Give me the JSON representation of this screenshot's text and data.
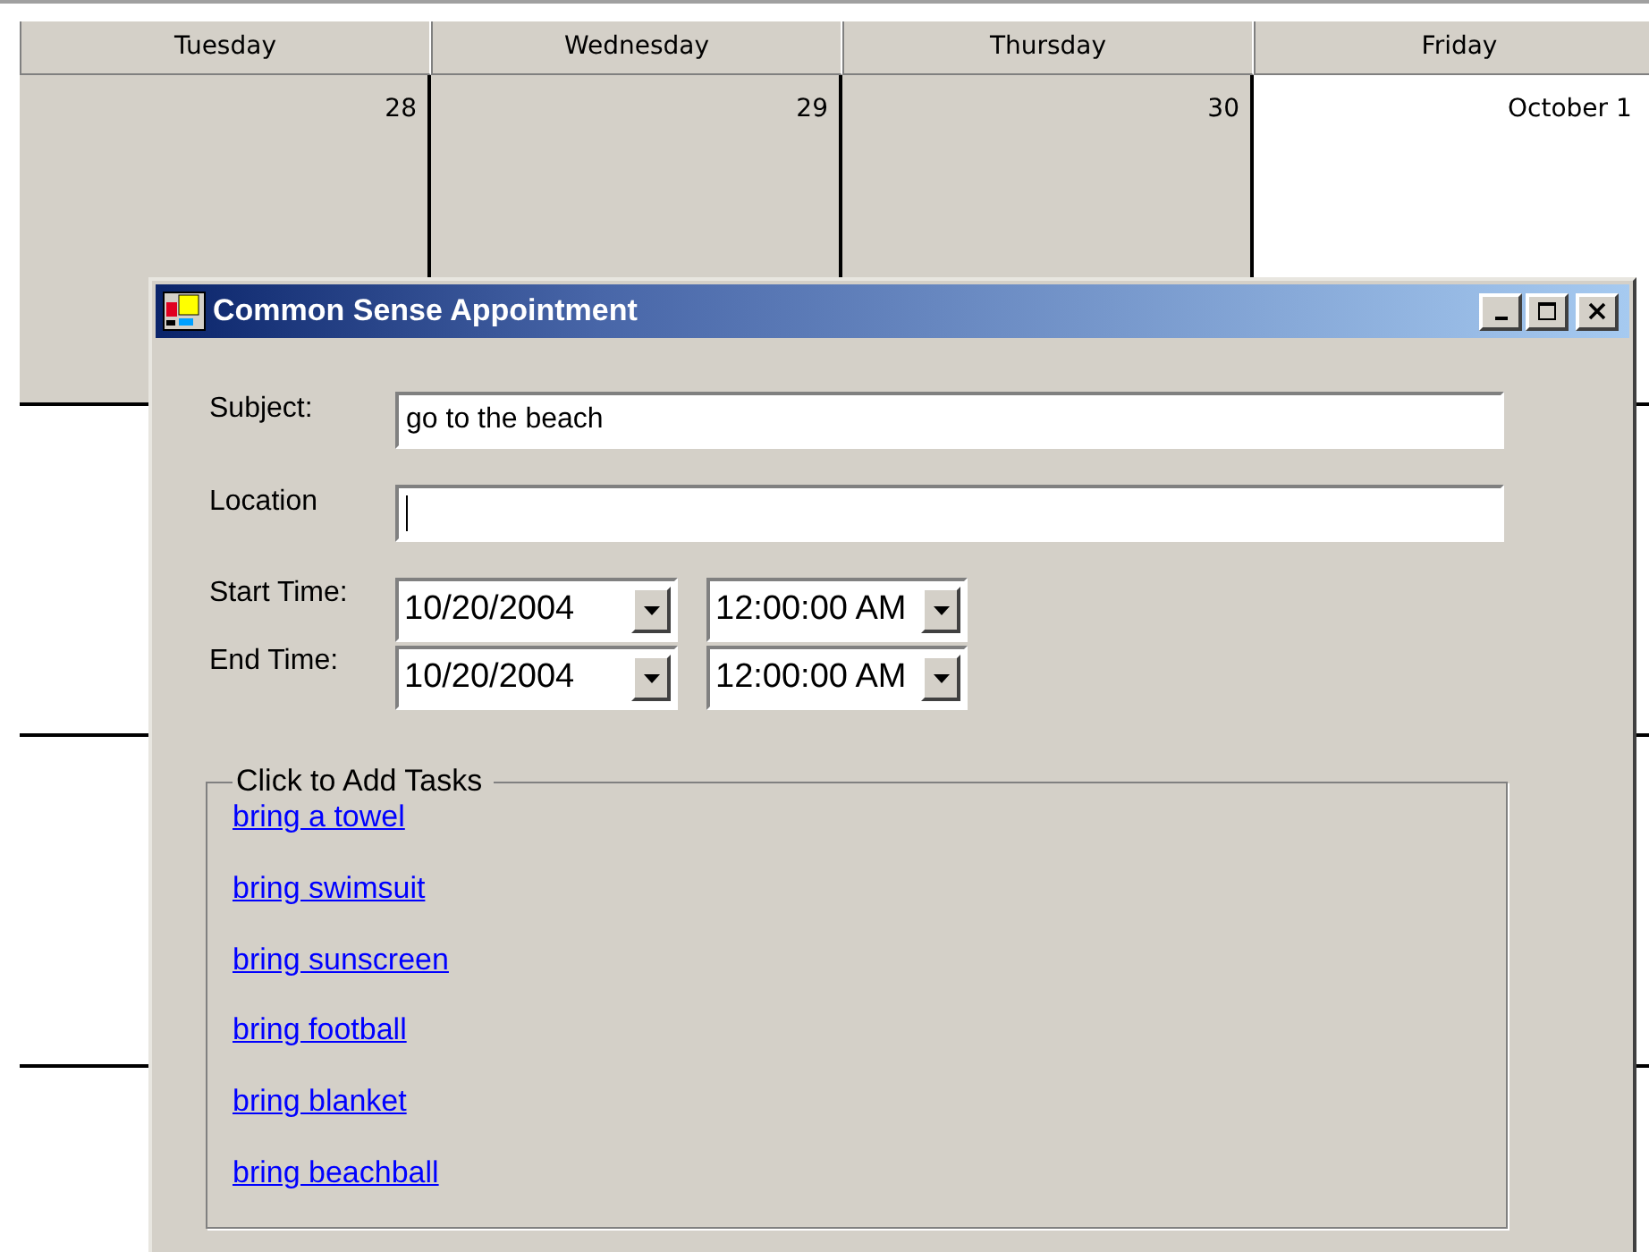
{
  "calendar": {
    "days": [
      "Tuesday",
      "Wednesday",
      "Thursday",
      "Friday"
    ],
    "weeks": [
      {
        "cells": [
          {
            "date": "28",
            "in_month": false
          },
          {
            "date": "29",
            "in_month": false
          },
          {
            "date": "30",
            "in_month": false
          },
          {
            "date": "October 1",
            "in_month": true
          }
        ]
      },
      {
        "cells": [
          {
            "in_month": true
          },
          {},
          {},
          {
            "in_month": true
          }
        ]
      },
      {
        "cells": [
          {
            "in_month": true
          },
          {},
          {},
          {
            "in_month": true
          }
        ]
      },
      {
        "cells": [
          {
            "in_month": true
          },
          {},
          {},
          {
            "in_month": true
          }
        ]
      }
    ]
  },
  "dialog": {
    "title": "Common Sense Appointment",
    "subject": {
      "label": "Subject:",
      "value": "go to the beach"
    },
    "location": {
      "label": "Location"
    },
    "times": [
      {
        "label": "Start Time:",
        "date": "10/20/2004",
        "time": "12:00:00 AM"
      },
      {
        "label": "End Time:",
        "date": "10/20/2004",
        "time": "12:00:00 AM"
      }
    ],
    "tasks": {
      "title": "Click to Add Tasks",
      "links": [
        "bring a towel",
        "bring swimsuit",
        "bring sunscreen",
        "bring football",
        "bring blanket",
        "bring beachball"
      ]
    }
  }
}
